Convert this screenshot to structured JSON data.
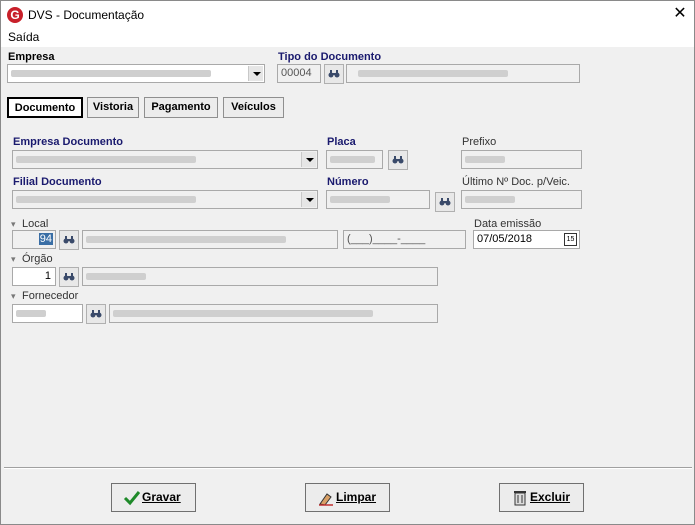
{
  "window": {
    "title": "DVS - Documentação",
    "app_icon_letter": "G",
    "close_glyph": "✕"
  },
  "menu": {
    "items": [
      {
        "label": "Saída"
      }
    ]
  },
  "header": {
    "empresa_label": "Empresa",
    "tipo_documento_label": "Tipo do Documento",
    "tipo_documento_code": "00004"
  },
  "tabs": [
    {
      "label": "Documento",
      "active": true
    },
    {
      "label": "Vistoria",
      "active": false
    },
    {
      "label": "Pagamento",
      "active": false
    },
    {
      "label": "Veículos",
      "active": false
    }
  ],
  "form": {
    "empresa_documento_label": "Empresa Documento",
    "placa_label": "Placa",
    "prefixo_label": "Prefixo",
    "filial_documento_label": "Filial Documento",
    "numero_label": "Número",
    "ultimo_doc_label": "Último Nº Doc. p/Veic.",
    "local_label": "Local",
    "local_code": "94",
    "phone_mask": "(___)____-____",
    "data_emissao_label": "Data emissão",
    "data_emissao_value": "07/05/2018",
    "calendar_glyph": "15",
    "orgao_label": "Órgão",
    "orgao_code": "1",
    "fornecedor_label": "Fornecedor"
  },
  "footer": {
    "gravar_label": "Gravar",
    "limpar_label": "Limpar",
    "excluir_label": "Excluir"
  }
}
